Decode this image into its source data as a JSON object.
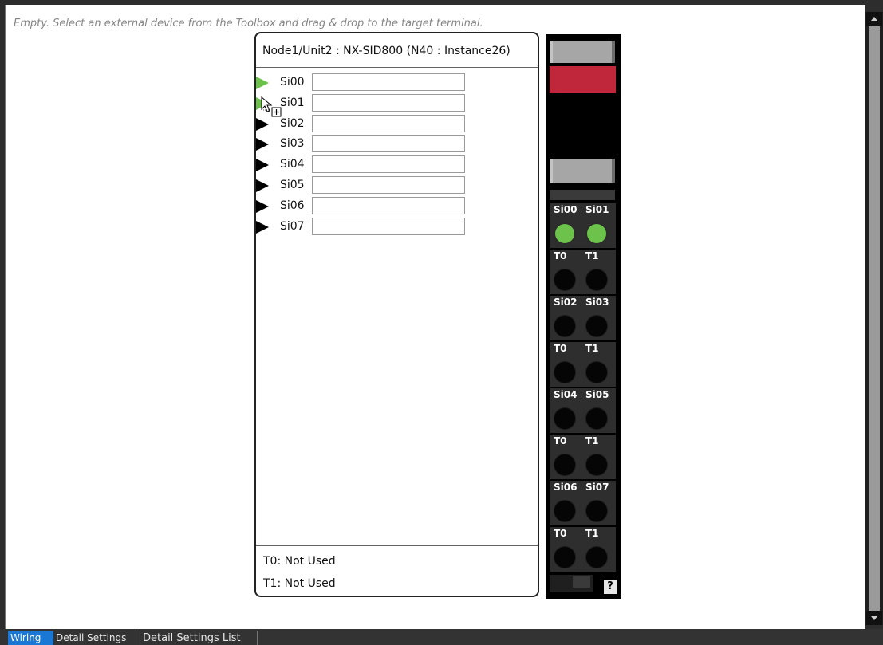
{
  "canvas": {
    "hint": "Empty. Select an external device from the Toolbox and drag & drop to the target terminal."
  },
  "unit": {
    "title": "Node1/Unit2 : NX-SID800 (N40 : Instance26)",
    "terminals": [
      {
        "label": "Si00",
        "value": "",
        "active": true
      },
      {
        "label": "Si01",
        "value": "",
        "active": true
      },
      {
        "label": "Si02",
        "value": "",
        "active": false
      },
      {
        "label": "Si03",
        "value": "",
        "active": false
      },
      {
        "label": "Si04",
        "value": "",
        "active": false
      },
      {
        "label": "Si05",
        "value": "",
        "active": false
      },
      {
        "label": "Si06",
        "value": "",
        "active": false
      },
      {
        "label": "Si07",
        "value": "",
        "active": false
      }
    ],
    "footer": {
      "t0": "T0: Not Used",
      "t1": "T1: Not Used"
    }
  },
  "device": {
    "groups": [
      {
        "left": "Si00",
        "right": "Si01",
        "lit": true
      },
      {
        "left": "T0",
        "right": "T1",
        "lit": false
      },
      {
        "left": "Si02",
        "right": "Si03",
        "lit": false
      },
      {
        "left": "T0",
        "right": "T1",
        "lit": false
      },
      {
        "left": "Si04",
        "right": "Si05",
        "lit": false
      },
      {
        "left": "T0",
        "right": "T1",
        "lit": false
      },
      {
        "left": "Si06",
        "right": "Si07",
        "lit": false
      },
      {
        "left": "T0",
        "right": "T1",
        "lit": false
      }
    ],
    "help_label": "?",
    "colors": {
      "indicator_red": "#c0273a",
      "lit_green": "#6cc24a",
      "body": "#000000"
    }
  },
  "tabs": [
    {
      "label": "Wiring",
      "active": true
    },
    {
      "label": "Detail Settings",
      "active": false
    },
    {
      "label": "Detail Settings List",
      "active": false
    }
  ],
  "scrollbar": {
    "up_icon": "chevron-up-icon",
    "down_icon": "chevron-down-icon"
  },
  "colors": {
    "accent": "#1a78d4",
    "terminal_active": "#6cc24a"
  }
}
